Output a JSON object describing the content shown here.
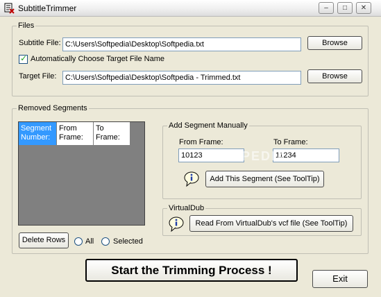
{
  "window": {
    "title": "SubtitleTrimmer",
    "controls": {
      "minimize": "–",
      "maximize": "□",
      "close": "✕"
    }
  },
  "files": {
    "legend": "Files",
    "subtitle_label": "Subtitle File:",
    "subtitle_value": "C:\\Users\\Softpedia\\Desktop\\Softpedia.txt",
    "browse1": "Browse",
    "auto_choose_label": "Automatically Choose Target File Name",
    "auto_choose_checked": true,
    "target_label": "Target File:",
    "target_value": "C:\\Users\\Softpedia\\Desktop\\Softpedia - Trimmed.txt",
    "browse2": "Browse"
  },
  "removed": {
    "legend": "Removed Segments",
    "columns": [
      "Segment Number:",
      "From Frame:",
      "To Frame:"
    ],
    "delete_rows": "Delete Rows",
    "radio_all": "All",
    "radio_selected": "Selected"
  },
  "add_segment": {
    "legend": "Add Segment Manually",
    "from_label": "From Frame:",
    "from_value": "10123",
    "to_label": "To Frame:",
    "to_value": "11234",
    "add_button": "Add This Segment (See ToolTip)"
  },
  "virtualdub": {
    "legend": "VirtualDub",
    "read_button": "Read From VirtualDub's vcf file (See ToolTip)"
  },
  "actions": {
    "start": "Start the Trimming Process !",
    "exit": "Exit"
  },
  "watermark": "SOFTPEDIA",
  "colors": {
    "selected_header": "#3399ff",
    "grid_bg": "#808080",
    "window_bg": "#ece9d8"
  }
}
